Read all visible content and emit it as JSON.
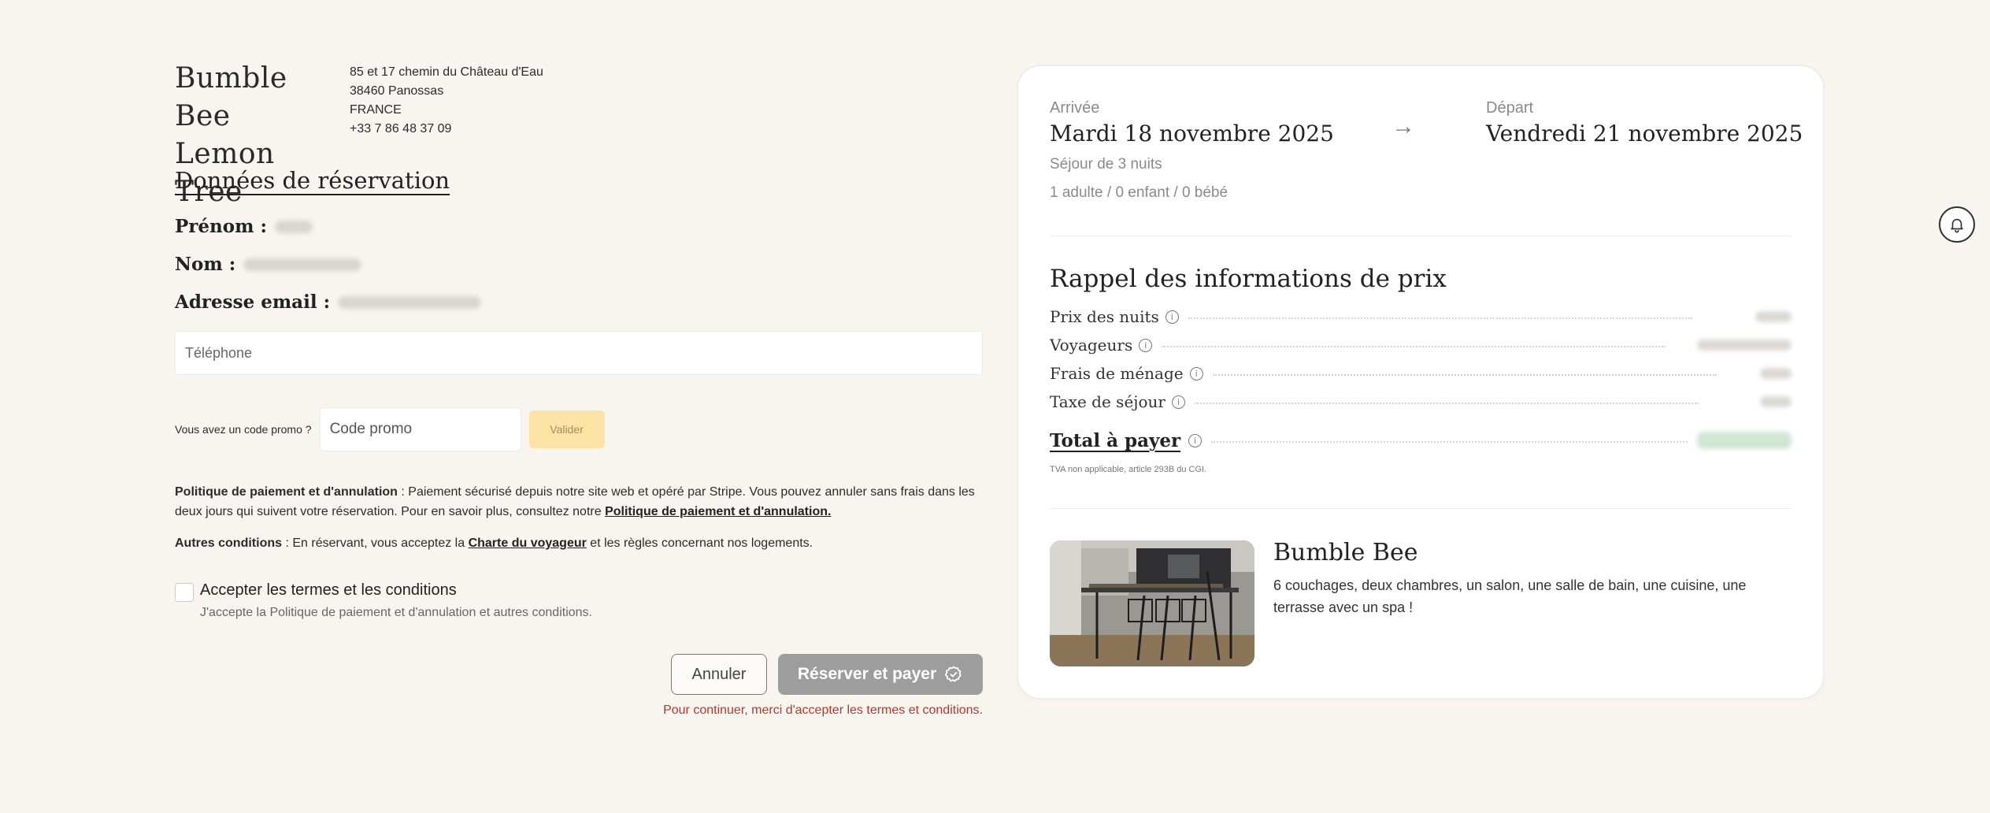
{
  "brand": {
    "name_line1": "Bumble Bee",
    "name_line2": "Lemon Tree",
    "address": [
      "85 et 17 chemin du Château d'Eau",
      "38460 Panossas",
      "FRANCE",
      "+33 7 86 48 37 09"
    ]
  },
  "reservation": {
    "title": "Données de réservation",
    "firstname_label": "Prénom :",
    "lastname_label": "Nom :",
    "email_label": "Adresse email :",
    "phone_placeholder": "Téléphone"
  },
  "promo": {
    "label": "Vous avez un code promo ?",
    "placeholder": "Code promo",
    "button": "Valider"
  },
  "policy": {
    "title": "Politique de paiement et d'annulation",
    "text": " : Paiement sécurisé depuis notre site web et opéré par Stripe. Vous pouvez annuler sans frais dans les deux jours qui suivent votre réservation. Pour en savoir plus, consultez notre ",
    "link": "Politique de paiement et d'annulation."
  },
  "conditions": {
    "title": "Autres conditions",
    "text_before": " : En réservant, vous acceptez la ",
    "link": "Charte du voyageur",
    "text_after": " et les règles concernant nos logements."
  },
  "terms": {
    "label": "Accepter les termes et les conditions",
    "sub": "J'accepte la Politique de paiement et d'annulation et autres conditions."
  },
  "actions": {
    "cancel": "Annuler",
    "pay": "Réserver et payer",
    "error": "Pour continuer, merci d'accepter les termes et conditions."
  },
  "summary": {
    "arrival_label": "Arrivée",
    "arrival_date": "Mardi 18 novembre 2025",
    "departure_label": "Départ",
    "departure_date": "Vendredi 21 novembre 2025",
    "arrow": "→",
    "stay": "Séjour de 3 nuits",
    "guests": "1 adulte / 0 enfant / 0 bébé"
  },
  "prices": {
    "title": "Rappel des informations de prix",
    "rows": [
      {
        "label": "Prix des nuits"
      },
      {
        "label": "Voyageurs"
      },
      {
        "label": "Frais de ménage"
      },
      {
        "label": "Taxe de séjour"
      }
    ],
    "total_label": "Total à payer",
    "tva": "TVA non applicable, article 293B du CGI."
  },
  "property": {
    "name": "Bumble Bee",
    "description": "6 couchages, deux chambres, un salon, une salle de bain, une cuisine, une terrasse avec un spa !"
  },
  "icons": {
    "info": "info-icon",
    "bell": "bell-icon",
    "pay": "verified-badge-icon"
  },
  "colors": {
    "background": "#f8f5f1",
    "promo_button": "#fbe3a6",
    "pay_button": "#9d9d9d",
    "error": "#b03a2e"
  }
}
